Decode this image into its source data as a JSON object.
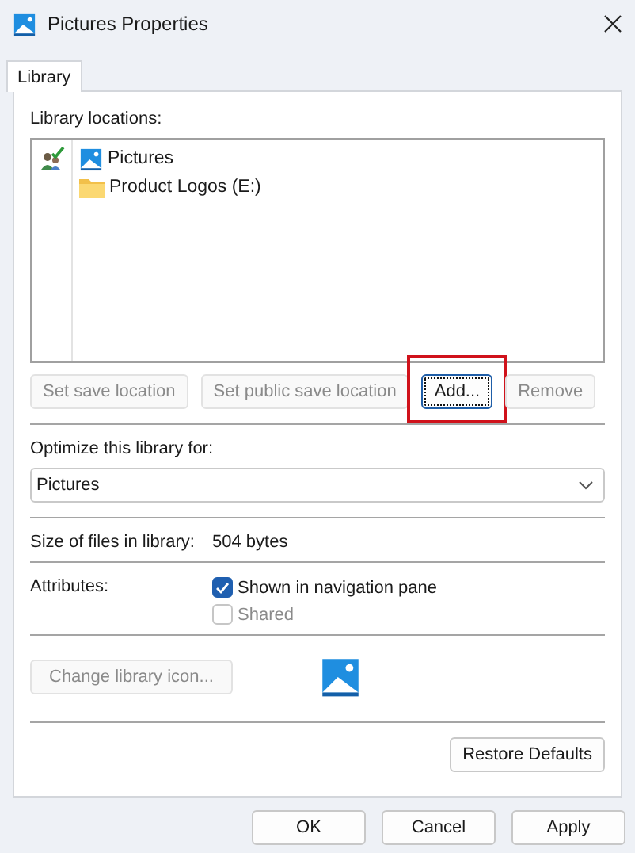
{
  "window": {
    "title": "Pictures Properties"
  },
  "tabs": [
    {
      "label": "Library",
      "selected": true
    }
  ],
  "locations": {
    "label": "Library locations:",
    "items": [
      {
        "name": "Pictures",
        "kind": "pictures",
        "default_save": true
      },
      {
        "name": "Product Logos (E:)",
        "kind": "folder",
        "default_save": false
      }
    ]
  },
  "location_buttons": [
    {
      "label": "Set save location",
      "disabled": true,
      "focused": false,
      "highlighted": false
    },
    {
      "label": "Set public save location",
      "disabled": true,
      "focused": false,
      "highlighted": false
    },
    {
      "label": "Add...",
      "disabled": false,
      "focused": true,
      "highlighted": true
    },
    {
      "label": "Remove",
      "disabled": true,
      "focused": false,
      "highlighted": false
    }
  ],
  "optimize": {
    "label": "Optimize this library for:",
    "value": "Pictures"
  },
  "size": {
    "label": "Size of files in library:",
    "value": "504 bytes"
  },
  "attributes": {
    "label": "Attributes:",
    "options": [
      {
        "label": "Shown in navigation pane",
        "checked": true,
        "disabled": false
      },
      {
        "label": "Shared",
        "checked": false,
        "disabled": true
      }
    ]
  },
  "icon_button": {
    "label": "Change library icon...",
    "disabled": true
  },
  "restore_button": {
    "label": "Restore Defaults",
    "disabled": false
  },
  "dialog_buttons": [
    {
      "label": "OK",
      "disabled": false
    },
    {
      "label": "Cancel",
      "disabled": false
    },
    {
      "label": "Apply",
      "disabled": false
    }
  ]
}
